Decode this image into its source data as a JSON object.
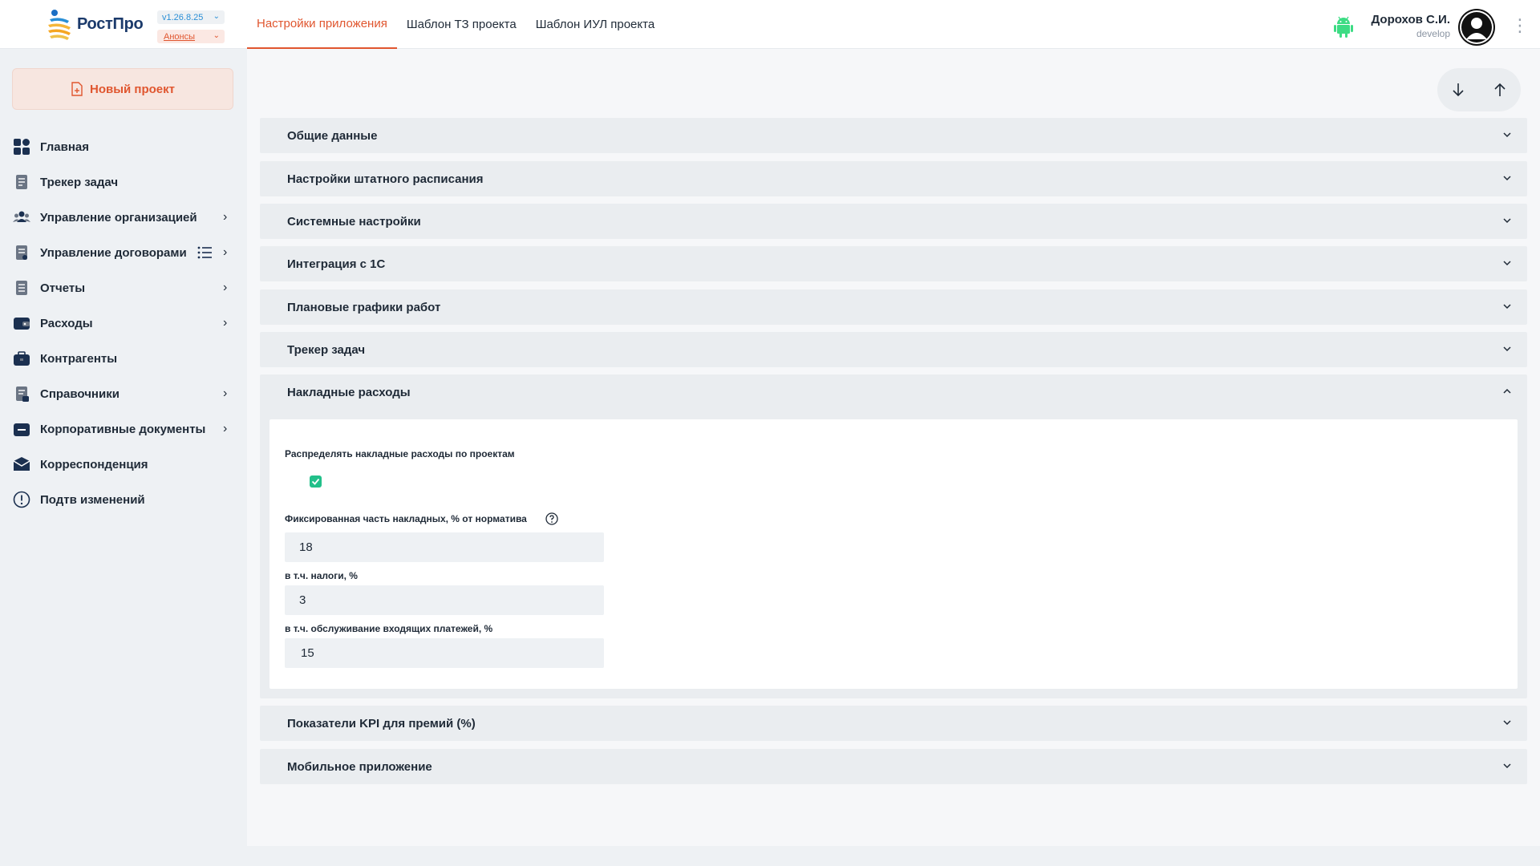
{
  "header": {
    "logo_text": "РостПро",
    "version": "v1.26.8.25",
    "announcements": "Анонсы",
    "tabs": [
      {
        "label": "Настройки приложения",
        "active": true
      },
      {
        "label": "Шаблон ТЗ проекта",
        "active": false
      },
      {
        "label": "Шаблон ИУЛ проекта",
        "active": false
      }
    ],
    "user": {
      "name": "Дорохов С.И.",
      "role": "develop"
    }
  },
  "sidebar": {
    "new_project": "Новый проект",
    "items": [
      {
        "label": "Главная",
        "icon": "dashboard-icon",
        "has_children": false
      },
      {
        "label": "Трекер задач",
        "icon": "task-tracker-icon",
        "has_children": false
      },
      {
        "label": "Управление организацией",
        "icon": "users-icon",
        "has_children": true
      },
      {
        "label": "Управление договорами",
        "icon": "contracts-icon",
        "has_children": true,
        "list_icon": true
      },
      {
        "label": "Отчеты",
        "icon": "reports-icon",
        "has_children": true
      },
      {
        "label": "Расходы",
        "icon": "wallet-icon",
        "has_children": true
      },
      {
        "label": "Контрагенты",
        "icon": "briefcase-icon",
        "has_children": false
      },
      {
        "label": "Справочники",
        "icon": "handbook-icon",
        "has_children": true
      },
      {
        "label": "Корпоративные документы",
        "icon": "folder-icon",
        "has_children": true
      },
      {
        "label": "Корреспонденция",
        "icon": "mail-icon",
        "has_children": false
      },
      {
        "label": "Подтв изменений",
        "icon": "alert-icon",
        "has_children": false
      }
    ]
  },
  "sections": [
    {
      "title": "Общие данные",
      "expanded": false
    },
    {
      "title": "Настройки штатного расписания",
      "expanded": false
    },
    {
      "title": "Системные настройки",
      "expanded": false
    },
    {
      "title": "Интеграция с 1С",
      "expanded": false
    },
    {
      "title": "Плановые графики работ",
      "expanded": false
    },
    {
      "title": "Трекер задач",
      "expanded": false
    },
    {
      "title": "Накладные расходы",
      "expanded": true
    },
    {
      "title": "Показатели KPI для премий (%)",
      "expanded": false
    },
    {
      "title": "Мобильное приложение",
      "expanded": false
    }
  ],
  "overhead": {
    "distribute_label": "Распределять накладные расходы по проектам",
    "distribute_checked": true,
    "fixed_label": "Фиксированная часть накладных, % от норматива",
    "fixed_value": "18",
    "taxes_label": "в т.ч. налоги, %",
    "taxes_value": "3",
    "payments_label": "в т.ч. обслуживание входящих платежей, %",
    "payments_value": "15"
  },
  "colors": {
    "accent": "#e0562f",
    "checkbox": "#22c08a",
    "link": "#2a8fd6",
    "android": "#3ddc84"
  }
}
